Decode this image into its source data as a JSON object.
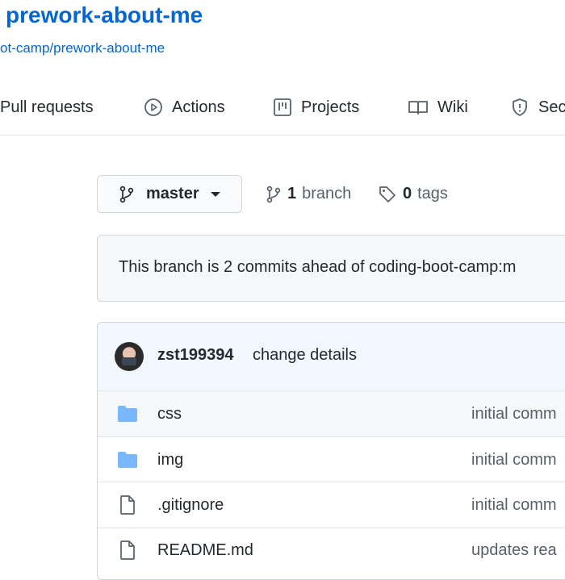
{
  "repo": {
    "title": "prework-about-me",
    "fork_link": "ot-camp/prework-about-me"
  },
  "nav": {
    "items": [
      {
        "label": "Pull requests",
        "icon": "pull-request-icon"
      },
      {
        "label": "Actions",
        "icon": "play-icon"
      },
      {
        "label": "Projects",
        "icon": "project-icon"
      },
      {
        "label": "Wiki",
        "icon": "book-icon"
      },
      {
        "label": "Sec",
        "icon": "shield-icon"
      }
    ]
  },
  "branch": {
    "current": "master",
    "branch_count": "1",
    "branch_label": "branch",
    "tag_count": "0",
    "tag_label": "tags"
  },
  "notice": {
    "text": "This branch is 2 commits ahead of coding-boot-camp:m"
  },
  "commit": {
    "user": "zst199394",
    "message": "change details"
  },
  "files": [
    {
      "name": "css",
      "type": "folder",
      "commit": "initial comm"
    },
    {
      "name": "img",
      "type": "folder",
      "commit": "initial comm"
    },
    {
      "name": ".gitignore",
      "type": "file",
      "commit": "initial comm"
    },
    {
      "name": "README.md",
      "type": "file",
      "commit": "updates rea"
    }
  ],
  "colors": {
    "link": "#0366d6",
    "folder": "#79b8ff",
    "text": "#24292e",
    "muted": "#586069"
  }
}
